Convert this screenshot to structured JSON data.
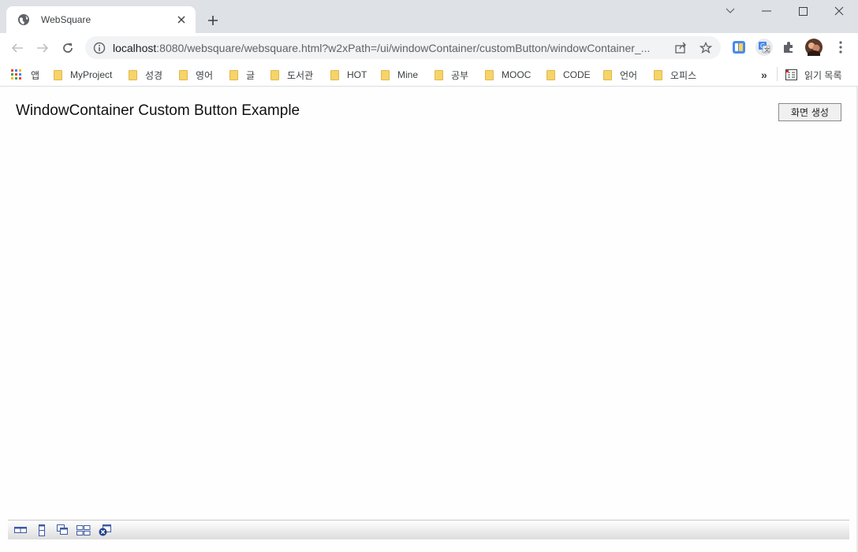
{
  "browser": {
    "tab": {
      "title": "WebSquare",
      "favicon": "globe-icon",
      "close_icon": "close-icon"
    },
    "new_tab_icon": "plus-icon",
    "window_controls": [
      "chevron-down-icon",
      "minimize-icon",
      "maximize-icon",
      "close-icon"
    ],
    "nav": [
      "back-icon",
      "forward-icon",
      "reload-icon"
    ],
    "omnibox": {
      "info_icon": "info-icon",
      "host": "localhost",
      "rest": ":8080/websquare/websquare.html?w2xPath=/ui/windowContainer/customButton/windowContainer_..."
    },
    "extensions": [
      "share-icon",
      "star-icon",
      "extension-blue-icon",
      "translate-icon",
      "puzzle-icon",
      "avatar",
      "menu-dots-icon"
    ]
  },
  "bookmarks": {
    "apps_label": "앱",
    "items": [
      {
        "label": "MyProject"
      },
      {
        "label": "성경"
      },
      {
        "label": "영어"
      },
      {
        "label": "글"
      },
      {
        "label": "도서관"
      },
      {
        "label": "HOT"
      },
      {
        "label": "Mine"
      },
      {
        "label": "공부"
      },
      {
        "label": "MOOC"
      },
      {
        "label": "CODE"
      },
      {
        "label": "언어"
      },
      {
        "label": "오피스"
      }
    ],
    "more_label": "»",
    "reading_list_label": "읽기 목록"
  },
  "page": {
    "title": "WindowContainer Custom Button Example",
    "create_button_label": "화면 생성",
    "window_toolbar_icons": [
      "tile-horizontal-icon",
      "tile-vertical-icon",
      "cascade-icon",
      "grid-icon",
      "close-all-icon"
    ]
  },
  "colors": {
    "tabstrip_bg": "#dee1e6",
    "omnibox_bg": "#f1f3f4",
    "folder": "#f6d46a",
    "window_toolbar_icon": "#3c5aa6"
  }
}
